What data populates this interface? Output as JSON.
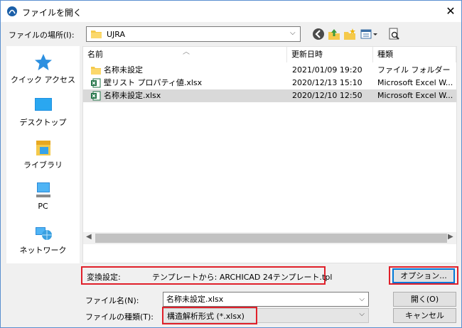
{
  "window": {
    "title": "ファイルを開く",
    "close_glyph": "✕"
  },
  "lookin": {
    "label": "ファイルの場所(I):",
    "value": "UJRA"
  },
  "toolbar": {
    "icons": [
      "back-icon",
      "up-folder-icon",
      "new-folder-icon",
      "view-menu-icon",
      "preview-icon"
    ]
  },
  "places": [
    {
      "label": "クイック アクセス",
      "icon": "quick-access-star-icon"
    },
    {
      "label": "デスクトップ",
      "icon": "desktop-icon"
    },
    {
      "label": "ライブラリ",
      "icon": "library-icon"
    },
    {
      "label": "PC",
      "icon": "pc-icon"
    },
    {
      "label": "ネットワーク",
      "icon": "network-icon"
    }
  ],
  "columns": {
    "name": "名前",
    "modified": "更新日時",
    "type": "種類"
  },
  "files": [
    {
      "name": "名称未設定",
      "modified": "2021/01/09 19:20",
      "type": "ファイル フォルダー",
      "icon": "folder-icon",
      "selected": false
    },
    {
      "name": "壁リスト プロパティ値.xlsx",
      "modified": "2020/12/13 15:10",
      "type": "Microsoft Excel W...",
      "icon": "excel-icon",
      "selected": false
    },
    {
      "name": "名称未設定.xlsx",
      "modified": "2020/12/10 12:50",
      "type": "Microsoft Excel W...",
      "icon": "excel-icon",
      "selected": true
    }
  ],
  "conversion": {
    "label": "変換設定:",
    "value": "テンプレートから: ARCHICAD 24テンプレート.tpl"
  },
  "buttons": {
    "options": "オプション...",
    "open": "開く(O)",
    "cancel": "キャンセル"
  },
  "filename": {
    "label": "ファイル名(N):",
    "value": "名称未設定.xlsx"
  },
  "filetype": {
    "label": "ファイルの種類(T):",
    "value": "構造解析形式 (*.xlsx)"
  },
  "colors": {
    "highlight_red": "#e0202a",
    "selection": "#d9d9d9",
    "focus_blue": "#0078d7",
    "folder_yellow": "#f5c94a",
    "excel_green": "#217346"
  }
}
